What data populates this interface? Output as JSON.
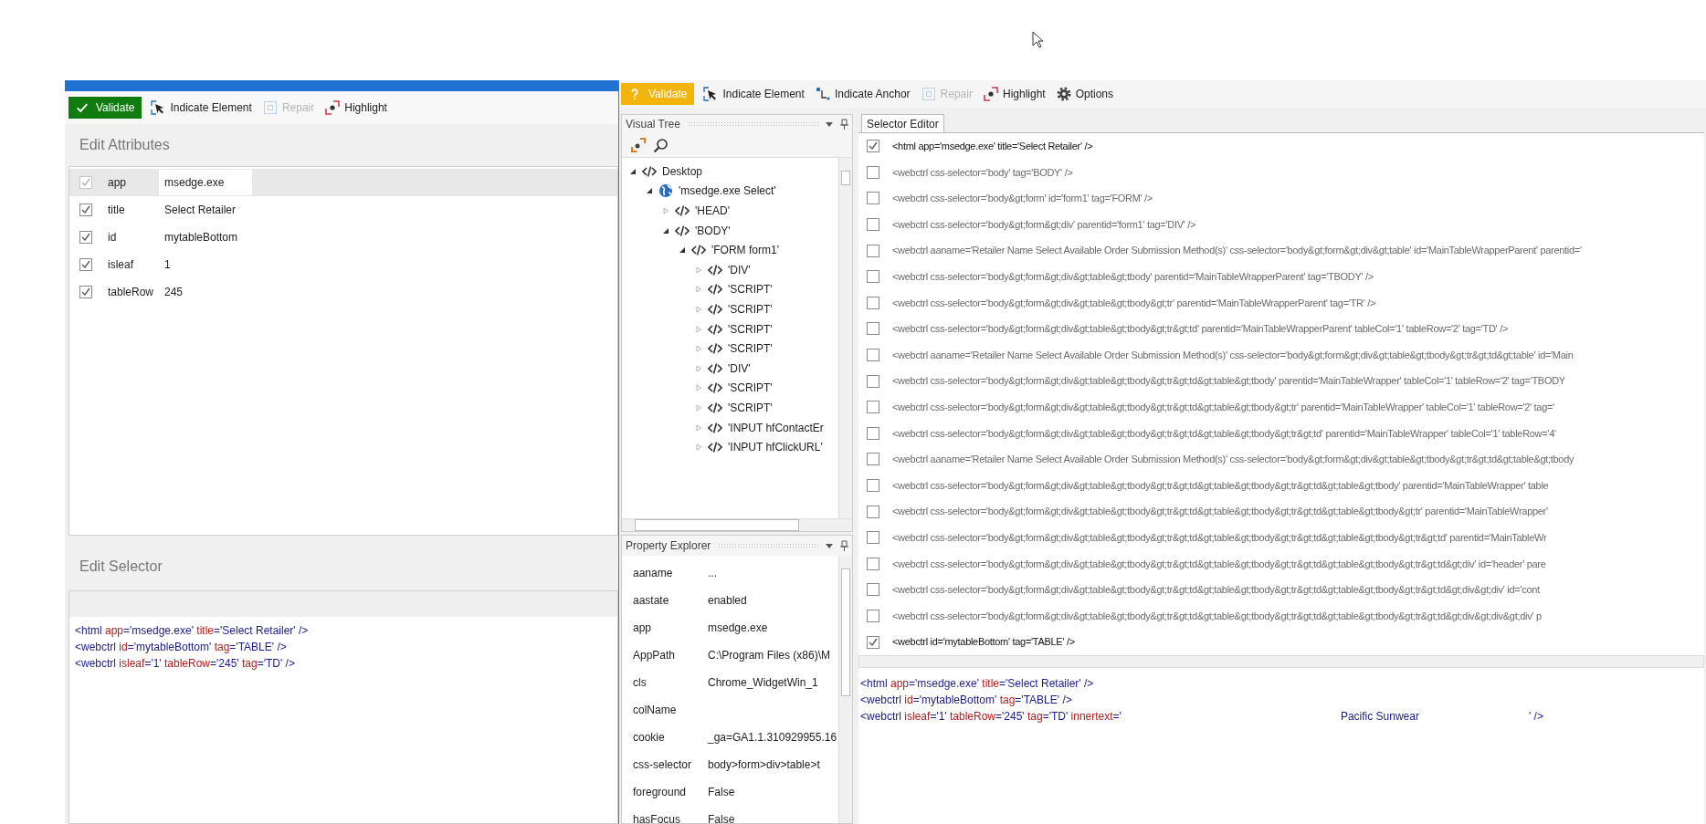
{
  "left_window": {
    "toolbar": [
      {
        "kind": "validate",
        "label": "Validate",
        "valid": true,
        "disabled": false
      },
      {
        "kind": "indicate",
        "label": "Indicate Element",
        "disabled": false
      },
      {
        "kind": "repair",
        "label": "Repair",
        "disabled": true
      },
      {
        "kind": "highlight",
        "label": "Highlight",
        "disabled": false
      }
    ],
    "attributes_title": "Edit Attributes",
    "attributes": [
      {
        "name": "app",
        "value": "msedge.exe",
        "checked": true,
        "disabled": true,
        "selected": true
      },
      {
        "name": "title",
        "value": "Select Retailer",
        "checked": true,
        "disabled": false,
        "selected": false
      },
      {
        "name": "id",
        "value": "mytableBottom",
        "checked": true,
        "disabled": false,
        "selected": false
      },
      {
        "name": "isleaf",
        "value": "1",
        "checked": true,
        "disabled": false,
        "selected": false
      },
      {
        "name": "tableRow",
        "value": "245",
        "checked": true,
        "disabled": false,
        "selected": false
      }
    ],
    "selector_title": "Edit Selector",
    "selector_lines": [
      [
        {
          "kind": "tag",
          "text": "<html "
        },
        {
          "kind": "attr",
          "text": "app"
        },
        {
          "kind": "value",
          "text": "='msedge.exe' "
        },
        {
          "kind": "attr",
          "text": "title"
        },
        {
          "kind": "value",
          "text": "='Select Retailer' />"
        }
      ],
      [
        {
          "kind": "tag",
          "text": "<webctrl "
        },
        {
          "kind": "attr",
          "text": "id"
        },
        {
          "kind": "value",
          "text": "='mytableBottom' "
        },
        {
          "kind": "attr",
          "text": "tag"
        },
        {
          "kind": "value",
          "text": "='TABLE' />"
        }
      ],
      [
        {
          "kind": "tag",
          "text": "<webctrl "
        },
        {
          "kind": "attr",
          "text": "isleaf"
        },
        {
          "kind": "value",
          "text": "='1' "
        },
        {
          "kind": "attr",
          "text": "tableRow"
        },
        {
          "kind": "value",
          "text": "='245' "
        },
        {
          "kind": "attr",
          "text": "tag"
        },
        {
          "kind": "value",
          "text": "='TD' />"
        }
      ]
    ]
  },
  "right_window": {
    "toolbar": [
      {
        "kind": "validate",
        "label": "Validate",
        "valid": false,
        "disabled": false
      },
      {
        "kind": "indicate",
        "label": "Indicate Element",
        "disabled": false
      },
      {
        "kind": "anchor",
        "label": "Indicate Anchor",
        "disabled": false
      },
      {
        "kind": "repair",
        "label": "Repair",
        "disabled": true
      },
      {
        "kind": "highlight",
        "label": "Highlight",
        "disabled": false
      },
      {
        "kind": "options",
        "label": "Options",
        "disabled": false
      }
    ],
    "visual_tree": {
      "title": "Visual Tree",
      "items": [
        {
          "kind": "code",
          "label": "Desktop",
          "expanded": true,
          "children": [
            {
              "kind": "globe",
              "label": "'msedge.exe Select'",
              "expanded": true,
              "children": [
                {
                  "kind": "code",
                  "label": "'HEAD'",
                  "expanded": false
                },
                {
                  "kind": "code",
                  "label": "'BODY'",
                  "expanded": true,
                  "children": [
                    {
                      "kind": "code",
                      "label": "'FORM  form1'",
                      "expanded": true,
                      "children": [
                        {
                          "kind": "code",
                          "label": "'DIV'",
                          "expanded": false
                        },
                        {
                          "kind": "code",
                          "label": "'SCRIPT'",
                          "expanded": false
                        },
                        {
                          "kind": "code",
                          "label": "'SCRIPT'",
                          "expanded": false
                        },
                        {
                          "kind": "code",
                          "label": "'SCRIPT'",
                          "expanded": false
                        },
                        {
                          "kind": "code",
                          "label": "'SCRIPT'",
                          "expanded": false
                        },
                        {
                          "kind": "code",
                          "label": "'DIV'",
                          "expanded": false
                        },
                        {
                          "kind": "code",
                          "label": "'SCRIPT'",
                          "expanded": false
                        },
                        {
                          "kind": "code",
                          "label": "'SCRIPT'",
                          "expanded": false
                        },
                        {
                          "kind": "code",
                          "label": "'INPUT  hfContactEr",
                          "expanded": false
                        },
                        {
                          "kind": "code",
                          "label": "'INPUT  hfClickURL'",
                          "expanded": false
                        }
                      ]
                    }
                  ]
                }
              ]
            }
          ]
        }
      ]
    },
    "property_explorer": {
      "title": "Property Explorer",
      "rows": [
        {
          "name": "aaname",
          "value": "..."
        },
        {
          "name": "aastate",
          "value": "enabled"
        },
        {
          "name": "app",
          "value": "msedge.exe"
        },
        {
          "name": "AppPath",
          "value": "C:\\Program Files (x86)\\M"
        },
        {
          "name": "cls",
          "value": "Chrome_WidgetWin_1"
        },
        {
          "name": "colName"
        },
        {
          "name": "cookie",
          "value": "_ga=GA1.1.310929955.16"
        },
        {
          "name": "css-selector",
          "value": "body>form>div>table>t"
        },
        {
          "name": "foreground",
          "value": "False"
        },
        {
          "name": "hasFocus",
          "value": "False"
        }
      ]
    },
    "selector_editor": {
      "tabs": [
        {
          "label": "Selector Editor",
          "selected": true
        }
      ],
      "rows": [
        {
          "text": "<html app='msedge.exe' title='Select Retailer' />",
          "checked": true
        },
        {
          "text": "<webctrl css-selector='body' tag='BODY' />",
          "checked": false
        },
        {
          "text": "<webctrl css-selector='body&gt;form' id='form1' tag='FORM' />",
          "checked": false
        },
        {
          "text": "<webctrl css-selector='body&gt;form&gt;div' parentid='form1' tag='DIV' />",
          "checked": false
        },
        {
          "text": "<webctrl aaname='Retailer Name Select Available Order Submission Method(s)' css-selector='body&gt;form&gt;div&gt;table' id='MainTableWrapperParent' parentid='",
          "checked": false
        },
        {
          "text": "<webctrl css-selector='body&gt;form&gt;div&gt;table&gt;tbody' parentid='MainTableWrapperParent' tag='TBODY' />",
          "checked": false
        },
        {
          "text": "<webctrl css-selector='body&gt;form&gt;div&gt;table&gt;tbody&gt;tr' parentid='MainTableWrapperParent' tag='TR' />",
          "checked": false
        },
        {
          "text": "<webctrl css-selector='body&gt;form&gt;div&gt;table&gt;tbody&gt;tr&gt;td' parentid='MainTableWrapperParent' tableCol='1' tableRow='2' tag='TD' />",
          "checked": false
        },
        {
          "text": "<webctrl aaname='Retailer Name Select Available Order Submission Method(s)' css-selector='body&gt;form&gt;div&gt;table&gt;tbody&gt;tr&gt;td&gt;table' id='Main",
          "checked": false
        },
        {
          "text": "<webctrl css-selector='body&gt;form&gt;div&gt;table&gt;tbody&gt;tr&gt;td&gt;table&gt;tbody' parentid='MainTableWrapper' tableCol='1' tableRow='2' tag='TBODY",
          "checked": false
        },
        {
          "text": "<webctrl css-selector='body&gt;form&gt;div&gt;table&gt;tbody&gt;tr&gt;td&gt;table&gt;tbody&gt;tr' parentid='MainTableWrapper' tableCol='1' tableRow='2' tag='",
          "checked": false
        },
        {
          "text": "<webctrl css-selector='body&gt;form&gt;div&gt;table&gt;tbody&gt;tr&gt;td&gt;table&gt;tbody&gt;tr&gt;td' parentid='MainTableWrapper' tableCol='1' tableRow='4'",
          "checked": false
        },
        {
          "text": "<webctrl aaname='Retailer Name Select Available Order Submission Method(s)' css-selector='body&gt;form&gt;div&gt;table&gt;tbody&gt;tr&gt;td&gt;table&gt;tbody",
          "checked": false
        },
        {
          "text": "<webctrl css-selector='body&gt;form&gt;div&gt;table&gt;tbody&gt;tr&gt;td&gt;table&gt;tbody&gt;tr&gt;td&gt;table&gt;tbody' parentid='MainTableWrapper' table",
          "checked": false
        },
        {
          "text": "<webctrl css-selector='body&gt;form&gt;div&gt;table&gt;tbody&gt;tr&gt;td&gt;table&gt;tbody&gt;tr&gt;td&gt;table&gt;tbody&gt;tr' parentid='MainTableWrapper'",
          "checked": false
        },
        {
          "text": "<webctrl css-selector='body&gt;form&gt;div&gt;table&gt;tbody&gt;tr&gt;td&gt;table&gt;tbody&gt;tr&gt;td&gt;table&gt;tbody&gt;tr&gt;td' parentid='MainTableWr",
          "checked": false
        },
        {
          "text": "<webctrl css-selector='body&gt;form&gt;div&gt;table&gt;tbody&gt;tr&gt;td&gt;table&gt;tbody&gt;tr&gt;td&gt;table&gt;tbody&gt;tr&gt;td&gt;div' id='header' pare",
          "checked": false
        },
        {
          "text": "<webctrl css-selector='body&gt;form&gt;div&gt;table&gt;tbody&gt;tr&gt;td&gt;table&gt;tbody&gt;tr&gt;td&gt;table&gt;tbody&gt;tr&gt;td&gt;div&gt;div' id='cont",
          "checked": false
        },
        {
          "text": "<webctrl css-selector='body&gt;form&gt;div&gt;table&gt;tbody&gt;tr&gt;td&gt;table&gt;tbody&gt;tr&gt;td&gt;table&gt;tbody&gt;tr&gt;td&gt;div&gt;div&gt;div' p",
          "checked": false
        },
        {
          "text": "<webctrl id='mytableBottom' tag='TABLE' />",
          "checked": true
        }
      ],
      "lines": [
        [
          {
            "kind": "tag",
            "text": "<html "
          },
          {
            "kind": "attr",
            "text": "app"
          },
          {
            "kind": "value",
            "text": "='msedge.exe' "
          },
          {
            "kind": "attr",
            "text": "title"
          },
          {
            "kind": "value",
            "text": "='Select Retailer' />"
          }
        ],
        [
          {
            "kind": "tag",
            "text": "<webctrl "
          },
          {
            "kind": "attr",
            "text": "id"
          },
          {
            "kind": "value",
            "text": "='mytableBottom' "
          },
          {
            "kind": "attr",
            "text": "tag"
          },
          {
            "kind": "value",
            "text": "='TABLE' />"
          }
        ],
        [
          {
            "kind": "tag",
            "text": "<webctrl "
          },
          {
            "kind": "attr",
            "text": "isleaf"
          },
          {
            "kind": "value",
            "text": "='1' "
          },
          {
            "kind": "attr",
            "text": "tableRow"
          },
          {
            "kind": "value",
            "text": "='245' "
          },
          {
            "kind": "attr",
            "text": "tag"
          },
          {
            "kind": "value",
            "text": "='TD' "
          },
          {
            "kind": "attr",
            "text": "innertext"
          },
          {
            "kind": "value",
            "text": "='"
          },
          {
            "kind": "spaced_value",
            "text": "Pacific Sunwear"
          },
          {
            "kind": "value",
            "text": "' />"
          }
        ]
      ]
    }
  }
}
